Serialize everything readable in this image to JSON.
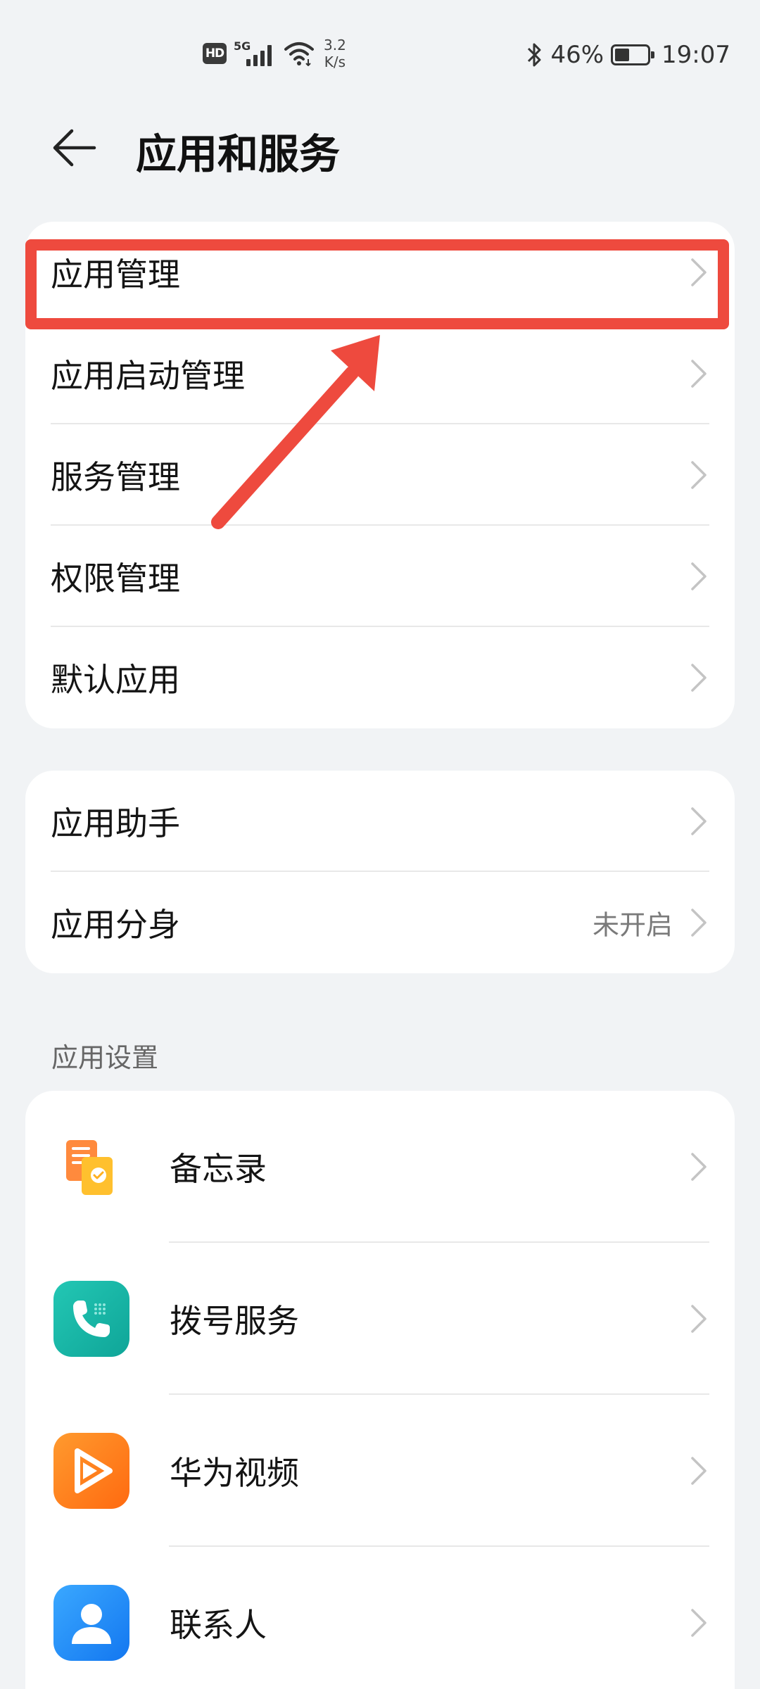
{
  "status_bar": {
    "hd": "HD",
    "network": "5G",
    "speed_value": "3.2",
    "speed_unit": "K/s",
    "battery_percent": "46%",
    "battery_level": 0.46,
    "time": "19:07",
    "icons": [
      "hd-icon",
      "signal-icon",
      "wifi-icon",
      "bluetooth-icon",
      "battery-icon"
    ]
  },
  "header": {
    "title": "应用和服务",
    "back_icon": "back-arrow-icon"
  },
  "group1": {
    "items": [
      {
        "label": "应用管理"
      },
      {
        "label": "应用启动管理"
      },
      {
        "label": "服务管理"
      },
      {
        "label": "权限管理"
      },
      {
        "label": "默认应用"
      }
    ]
  },
  "group2": {
    "items": [
      {
        "label": "应用助手",
        "value": ""
      },
      {
        "label": "应用分身",
        "value": "未开启"
      }
    ]
  },
  "app_settings": {
    "section_title": "应用设置",
    "apps": [
      {
        "label": "备忘录",
        "icon": "notepad-icon"
      },
      {
        "label": "拨号服务",
        "icon": "phone-icon"
      },
      {
        "label": "华为视频",
        "icon": "video-icon"
      },
      {
        "label": "联系人",
        "icon": "contacts-icon"
      }
    ]
  },
  "colors": {
    "background": "#f1f3f5",
    "card": "#ffffff",
    "annotation_red": "#ee4a3e",
    "phone_teal": "#19b7a7",
    "video_orange": "#ff7a1a",
    "contacts_blue": "#1e90ff",
    "notepad_orange": "#ff8a3d"
  }
}
